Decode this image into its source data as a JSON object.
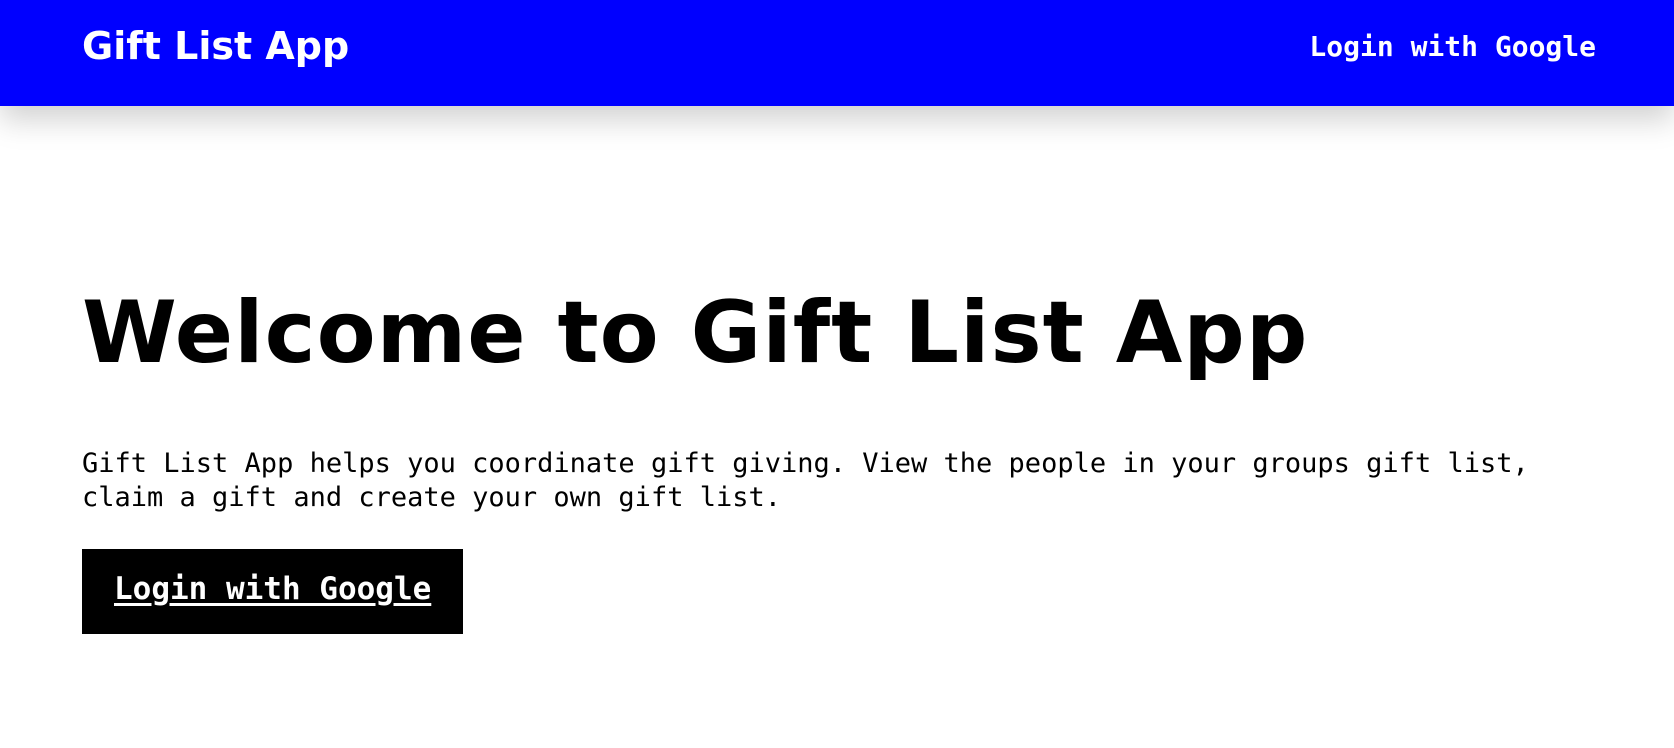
{
  "header": {
    "brand": "Gift List App",
    "login_label": "Login with Google"
  },
  "main": {
    "title": "Welcome to Gift List App",
    "description": "Gift List App helps you coordinate gift giving. View the people in your groups gift list, claim a gift and create your own gift list.",
    "cta_label": "Login with Google"
  },
  "colors": {
    "header_background": "#0000ff",
    "header_text": "#ffffff",
    "button_background": "#000000",
    "button_text": "#ffffff",
    "page_background": "#ffffff"
  }
}
